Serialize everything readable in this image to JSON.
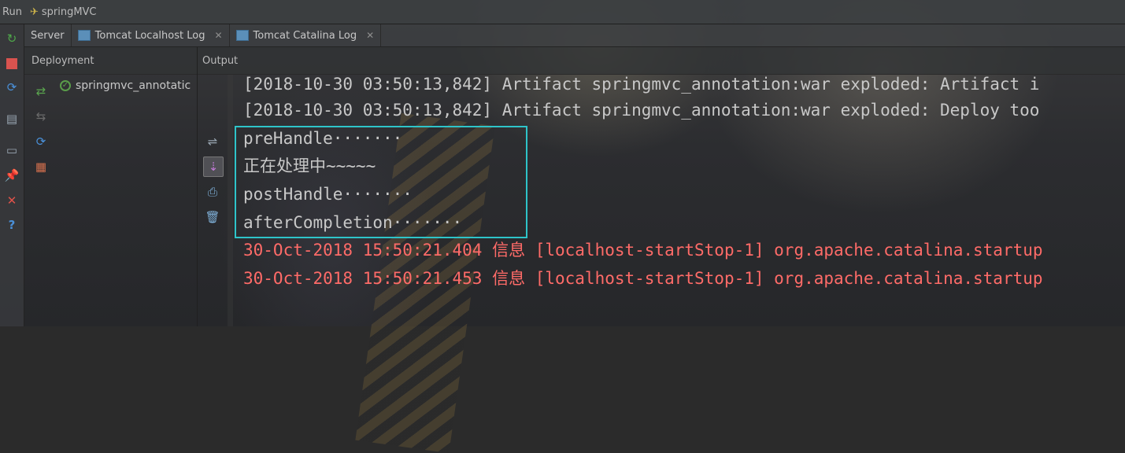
{
  "titlebar": {
    "run_label": "Run",
    "config_name": "springMVC"
  },
  "tabs": [
    {
      "label": "Server"
    },
    {
      "label": "Tomcat Localhost Log",
      "close": "✕"
    },
    {
      "label": "Tomcat Catalina Log",
      "close": "✕"
    }
  ],
  "panels": {
    "deployment_header": "Deployment",
    "output_header": "Output"
  },
  "deployment": {
    "item_label": "springmvc_annotatic"
  },
  "console": {
    "lines": [
      "[2018-10-30 03:50:13,842] Artifact springmvc_annotation:war exploded: Artifact i",
      "[2018-10-30 03:50:13,842] Artifact springmvc_annotation:war exploded: Deploy too",
      "preHandle·······",
      "正在处理中~~~~~",
      "postHandle·······",
      "afterCompletion·······",
      "30-Oct-2018 15:50:21.404 信息 [localhost-startStop-1] org.apache.catalina.startup",
      "30-Oct-2018 15:50:21.453 信息 [localhost-startStop-1] org.apache.catalina.startup"
    ]
  },
  "colors": {
    "highlight_border": "#2ec4c9",
    "error_text": "#ff6b68",
    "normal_text": "#c8c8c8"
  }
}
